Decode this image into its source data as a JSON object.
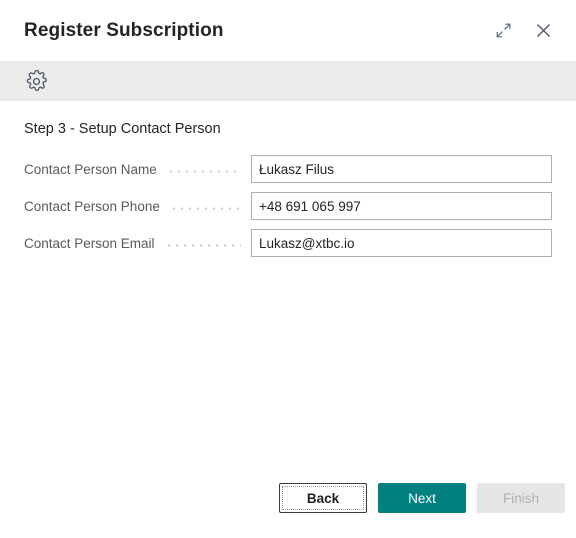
{
  "window": {
    "title": "Register Subscription",
    "expand_icon": "expand-diagonal-icon",
    "close_icon": "close-icon"
  },
  "toolbar": {
    "settings_icon": "gear-icon"
  },
  "main": {
    "step_title": "Step 3 - Setup Contact Person",
    "fields": [
      {
        "label": "Contact Person Name",
        "value": "Łukasz Filus",
        "placeholder": ""
      },
      {
        "label": "Contact Person Phone",
        "value": "+48 691 065 997",
        "placeholder": ""
      },
      {
        "label": "Contact Person Email",
        "value": "Lukasz@xtbc.io",
        "placeholder": ""
      }
    ]
  },
  "footer": {
    "back_label": "Back",
    "next_label": "Next",
    "finish_label": "Finish"
  },
  "colors": {
    "accent_teal": "#00807f",
    "toolbar_bg": "#ececec",
    "disabled_bg": "#e6e6e6",
    "disabled_text": "#b4b2b0",
    "title_text": "#252423",
    "label_text": "#5a5a5a",
    "input_border": "#afafaf"
  }
}
